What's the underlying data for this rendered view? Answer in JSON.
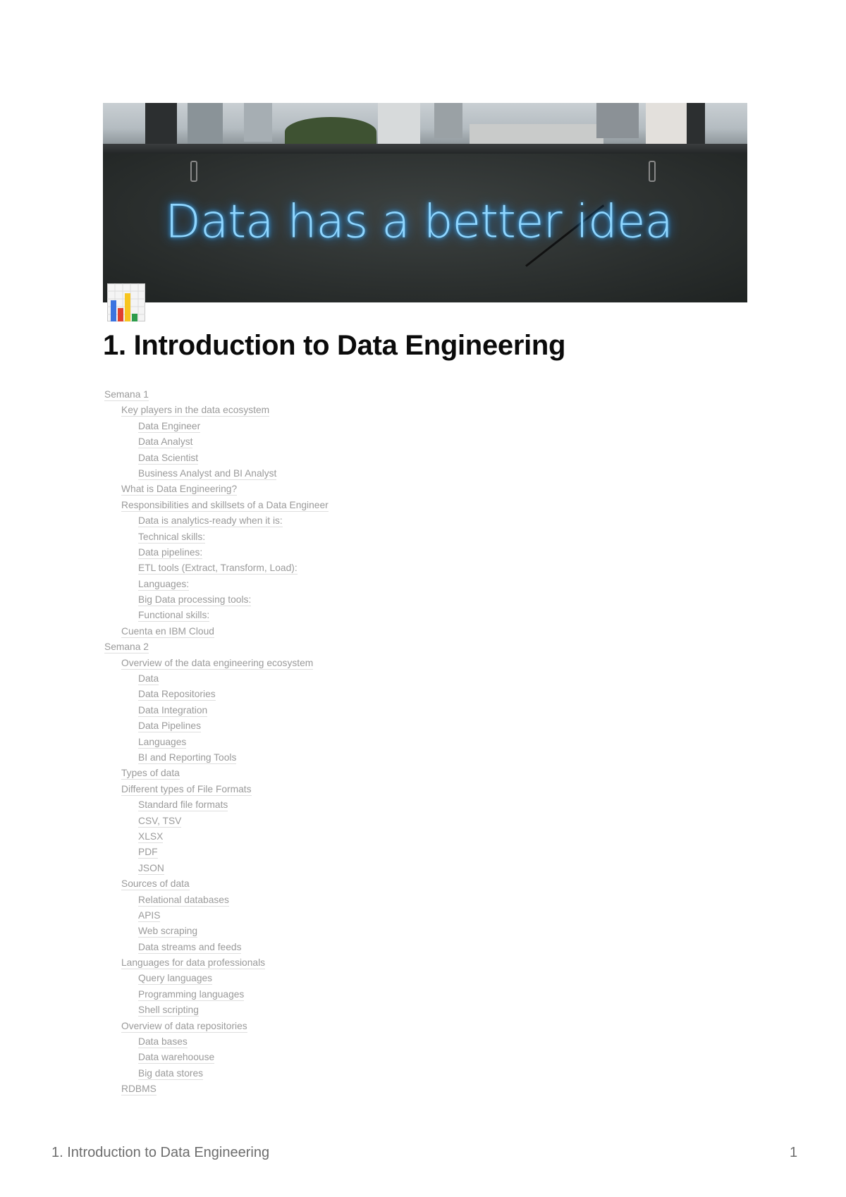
{
  "cover": {
    "alt": "Neon sign on a dark wall below a window overlooking city buildings",
    "neon_text": "Data has a better idea"
  },
  "page": {
    "icon": "bar-chart-icon",
    "title": "1. Introduction to Data Engineering"
  },
  "toc": [
    {
      "level": 0,
      "label": "Semana 1"
    },
    {
      "level": 1,
      "label": "Key players in the data ecosystem"
    },
    {
      "level": 2,
      "label": "Data Engineer"
    },
    {
      "level": 2,
      "label": "Data Analyst"
    },
    {
      "level": 2,
      "label": "Data Scientist"
    },
    {
      "level": 2,
      "label": "Business Analyst and BI Analyst"
    },
    {
      "level": 1,
      "label": "What is Data Engineering?"
    },
    {
      "level": 1,
      "label": "Responsibilities and skillsets of a Data Engineer"
    },
    {
      "level": 2,
      "label": "Data is analytics-ready when it is:"
    },
    {
      "level": 2,
      "label": "Technical skills:"
    },
    {
      "level": 2,
      "label": "Data pipelines:"
    },
    {
      "level": 2,
      "label": "ETL tools (Extract, Transform, Load):"
    },
    {
      "level": 2,
      "label": "Languages:"
    },
    {
      "level": 2,
      "label": "Big Data processing tools:"
    },
    {
      "level": 2,
      "label": "Functional skills:"
    },
    {
      "level": 1,
      "label": "Cuenta en IBM Cloud"
    },
    {
      "level": 0,
      "label": "Semana 2"
    },
    {
      "level": 1,
      "label": "Overview of the data engineering ecosystem"
    },
    {
      "level": 2,
      "label": "Data"
    },
    {
      "level": 2,
      "label": "Data Repositories"
    },
    {
      "level": 2,
      "label": "Data Integration"
    },
    {
      "level": 2,
      "label": "Data Pipelines"
    },
    {
      "level": 2,
      "label": "Languages"
    },
    {
      "level": 2,
      "label": "BI and Reporting Tools"
    },
    {
      "level": 1,
      "label": "Types of data"
    },
    {
      "level": 1,
      "label": "Different types of File Formats"
    },
    {
      "level": 2,
      "label": "Standard file formats"
    },
    {
      "level": 2,
      "label": "CSV, TSV"
    },
    {
      "level": 2,
      "label": "XLSX"
    },
    {
      "level": 2,
      "label": "PDF"
    },
    {
      "level": 2,
      "label": "JSON"
    },
    {
      "level": 1,
      "label": "Sources of data"
    },
    {
      "level": 2,
      "label": "Relational databases"
    },
    {
      "level": 2,
      "label": "APIS"
    },
    {
      "level": 2,
      "label": "Web scraping"
    },
    {
      "level": 2,
      "label": "Data streams and feeds"
    },
    {
      "level": 1,
      "label": "Languages for data professionals"
    },
    {
      "level": 2,
      "label": "Query languages"
    },
    {
      "level": 2,
      "label": "Programming languages"
    },
    {
      "level": 2,
      "label": "Shell scripting"
    },
    {
      "level": 1,
      "label": "Overview of data repositories"
    },
    {
      "level": 2,
      "label": "Data bases"
    },
    {
      "level": 2,
      "label": "Data warehoouse"
    },
    {
      "level": 2,
      "label": "Big data stores"
    },
    {
      "level": 1,
      "label": "RDBMS"
    }
  ],
  "footer": {
    "title": "1. Introduction to Data Engineering",
    "page_number": "1"
  },
  "colors": {
    "toc_link": "#9a9a9a",
    "title": "#0b0b0b",
    "footer": "#6d6d6d",
    "neon": "#8fd6ff"
  }
}
